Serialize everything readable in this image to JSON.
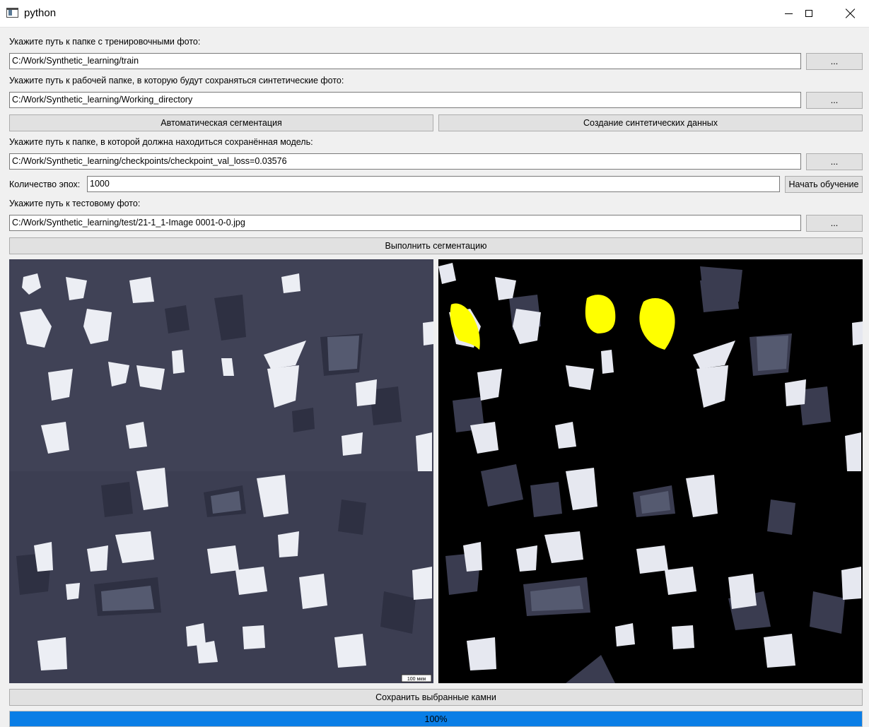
{
  "window": {
    "title": "python"
  },
  "train": {
    "label": "Укажите путь к папке с тренировочными фото:",
    "value": "C:/Work/Synthetic_learning/train",
    "browse_label": "..."
  },
  "workdir": {
    "label": "Укажите путь к рабочей папке, в которую будут сохраняться синтетические фото:",
    "value": "C:/Work/Synthetic_learning/Working_directory",
    "browse_label": "..."
  },
  "actions": {
    "auto_segmentation": "Автоматическая сегментация",
    "create_synthetic": "Создание синтетических данных"
  },
  "model": {
    "label": "Укажите путь к папке, в которой должна находиться сохранённая модель:",
    "value": "C:/Work/Synthetic_learning/checkpoints/checkpoint_val_loss=0.03576",
    "browse_label": "..."
  },
  "epochs": {
    "label": "Количество эпох:",
    "value": "1000",
    "start_label": "Начать обучение"
  },
  "test": {
    "label": "Укажите путь к тестовому фото:",
    "value": "C:/Work/Synthetic_learning/test/21-1_1-Image 0001-0-0.jpg",
    "browse_label": "..."
  },
  "segment_button": "Выполнить сегментацию",
  "images": {
    "original_scale": "100 мкм"
  },
  "save_button": "Сохранить выбранные камни",
  "progress": {
    "value": 1.0,
    "text": "100%"
  },
  "colors": {
    "accent": "#0a7ee6",
    "highlight": "#ffff00",
    "background": "#f0f0f0"
  }
}
